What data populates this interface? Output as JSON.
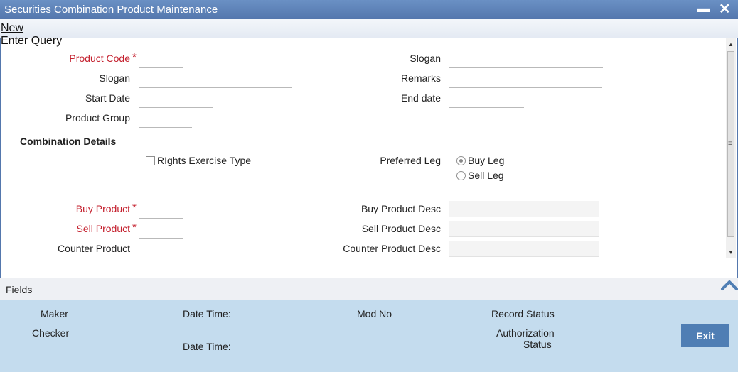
{
  "window": {
    "title": "Securities Combination Product Maintenance",
    "minimize": "▬",
    "close": "✕"
  },
  "menu": {
    "new": "New",
    "enter_query": "Enter Query"
  },
  "form": {
    "product_code": "Product Code",
    "slogan_left": "Slogan",
    "start_date": "Start Date",
    "product_group": "Product Group",
    "slogan_right": "Slogan",
    "remarks": "Remarks",
    "end_date": "End date",
    "required_mark": "*"
  },
  "combination": {
    "title": "Combination Details",
    "rights_exercise_type": "RIghts Exercise Type",
    "rights_exercise_checked": false,
    "preferred_leg": "Preferred Leg",
    "buy_leg": "Buy Leg",
    "sell_leg": "Sell Leg",
    "preferred_leg_value": "Buy Leg",
    "buy_product": "Buy Product",
    "sell_product": "Sell Product",
    "counter_product": "Counter Product",
    "buy_product_desc": "Buy Product Desc",
    "sell_product_desc": "Sell Product Desc",
    "counter_product_desc": "Counter Product Desc"
  },
  "fields": {
    "label": "Fields"
  },
  "footer": {
    "maker": "Maker",
    "checker": "Checker",
    "date_time": "Date Time:",
    "mod_no": "Mod No",
    "record_status": "Record Status",
    "authorization": "Authorization",
    "status": "Status",
    "exit": "Exit"
  },
  "colors": {
    "title_bar": "#5477ad",
    "required": "#c4202e",
    "footer": "#c4dcee",
    "exit_button": "#4f7eb4"
  }
}
